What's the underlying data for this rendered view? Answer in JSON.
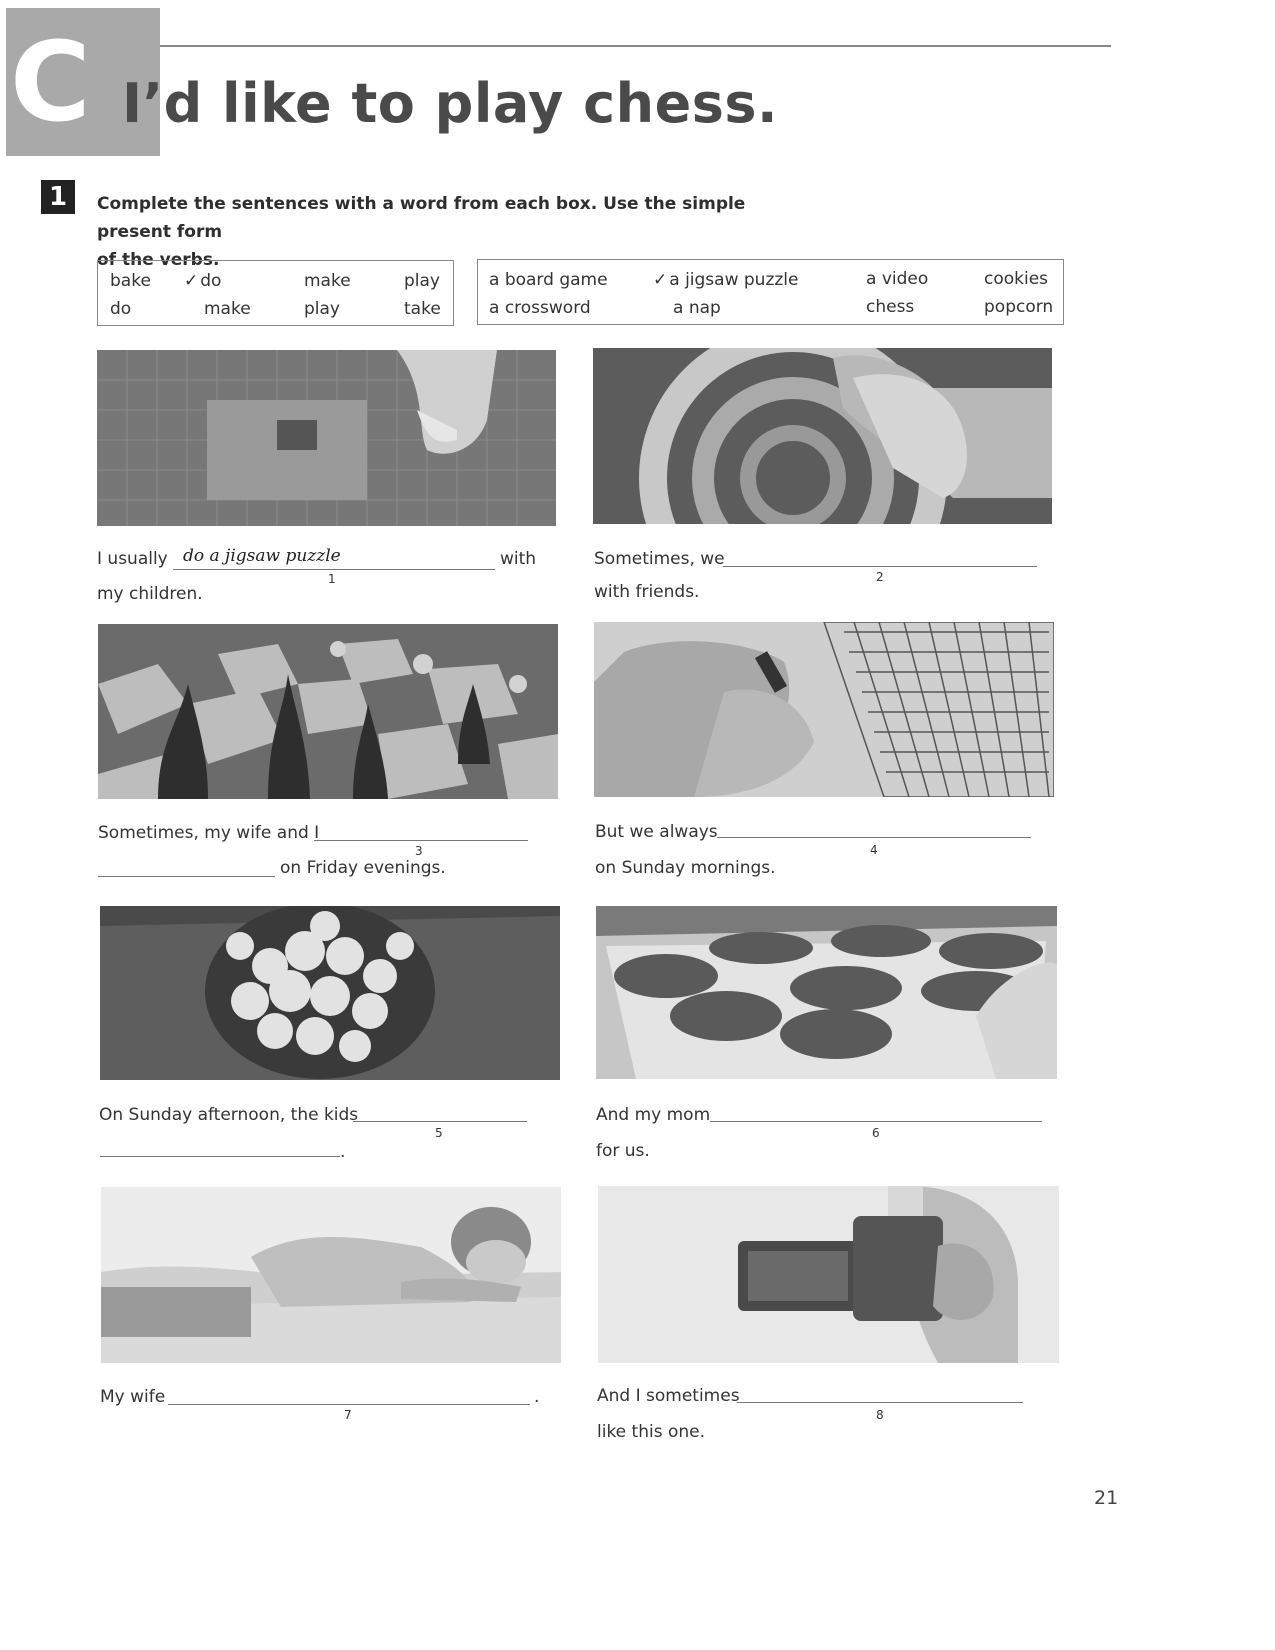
{
  "header": {
    "badge_letter": "C",
    "title": "I’d like to play chess."
  },
  "exercise": {
    "number": "1",
    "instruction_line1": "Complete the sentences with a word from each box. Use the simple present form",
    "instruction_line2": "of the verbs."
  },
  "verb_box": {
    "row1": [
      "bake",
      "do",
      "make",
      "play"
    ],
    "row2": [
      "do",
      "make",
      "play",
      "take"
    ],
    "checked": "do"
  },
  "noun_box": {
    "row1": [
      "a board game",
      "a jigsaw puzzle",
      "a video",
      "cookies"
    ],
    "row2": [
      "a crossword",
      "a nap",
      "chess",
      "popcorn"
    ],
    "checked": "a jigsaw puzzle"
  },
  "tick_mark": "✓",
  "items": [
    {
      "n": "1",
      "before": "I usually",
      "answer": "do a jigsaw puzzle",
      "after": "with",
      "line2": "my children."
    },
    {
      "n": "2",
      "before": "Sometimes, we",
      "line2": "with friends."
    },
    {
      "n": "3",
      "before": "Sometimes, my wife and I",
      "line2": "on Friday evenings."
    },
    {
      "n": "4",
      "before": "But we always",
      "line2": "on Sunday mornings."
    },
    {
      "n": "5",
      "before": "On Sunday afternoon, the kids",
      "line2": "."
    },
    {
      "n": "6",
      "before": "And my mom",
      "line2": "for us."
    },
    {
      "n": "7",
      "before": "My wife",
      "after": "."
    },
    {
      "n": "8",
      "before": "And I sometimes",
      "line2": "like this one."
    }
  ],
  "photos": [
    "jigsaw-puzzle",
    "board-game",
    "chess",
    "crossword",
    "popcorn",
    "cookies",
    "nap",
    "video-camera"
  ],
  "page_number": "21"
}
